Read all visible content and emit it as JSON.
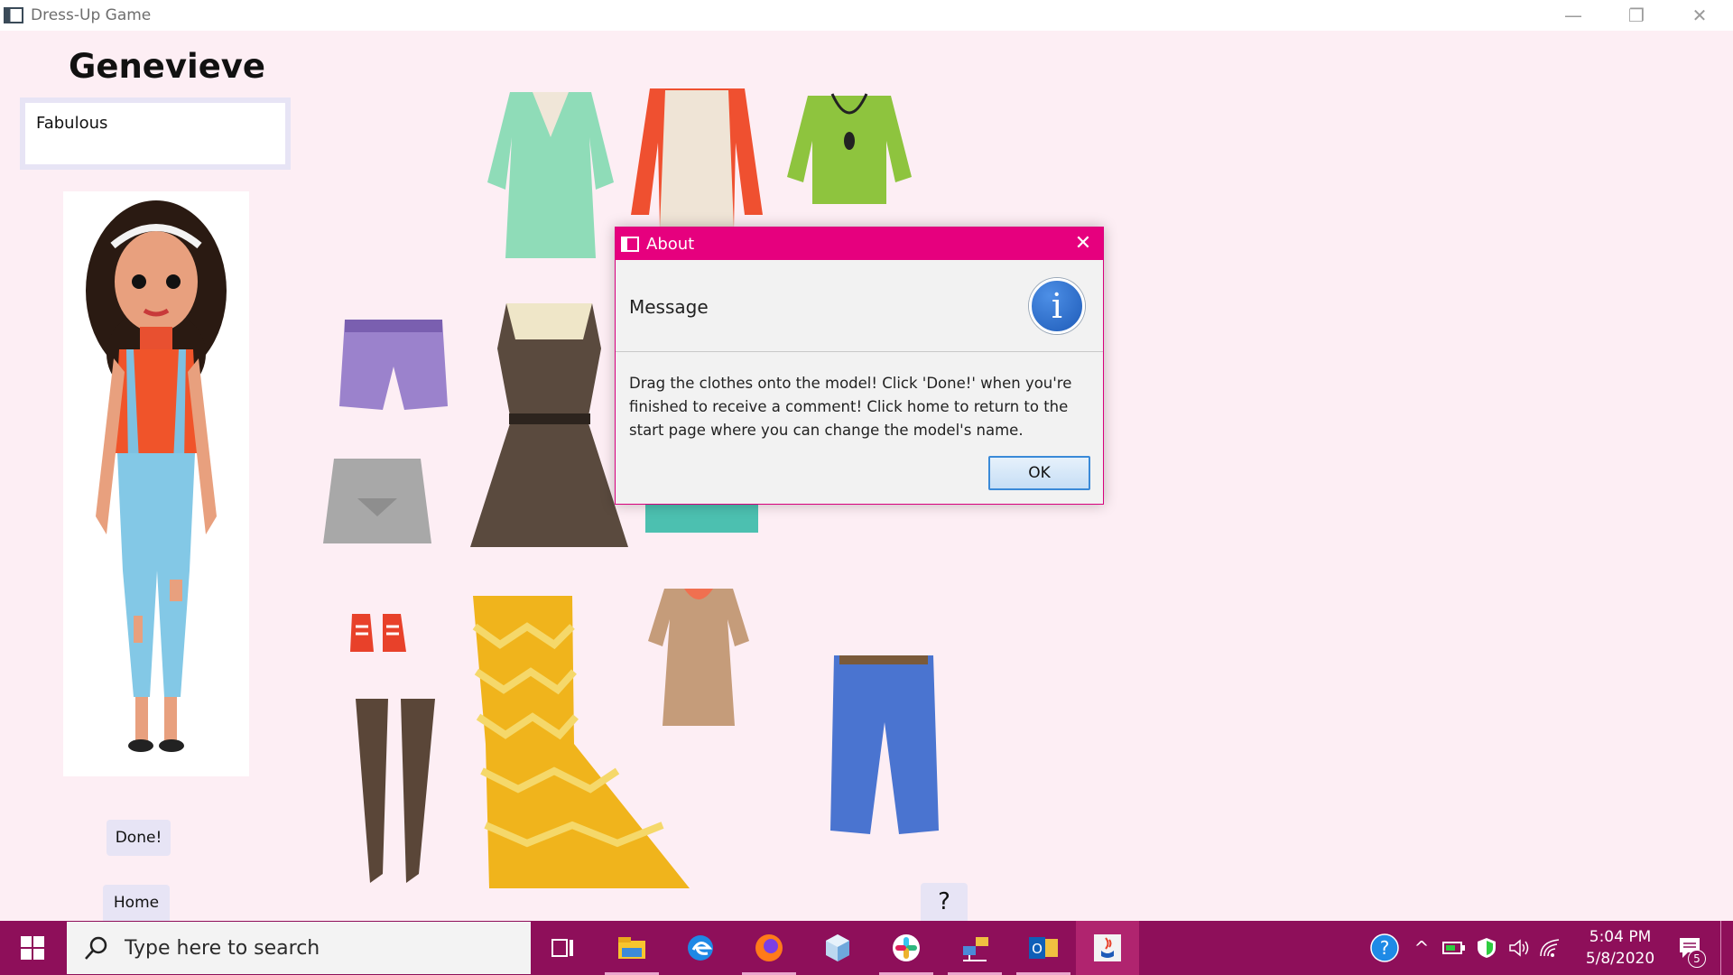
{
  "window": {
    "title": "Dress-Up Game"
  },
  "game": {
    "model_name": "Genevieve",
    "comment": "Fabulous",
    "done_label": "Done!",
    "home_label": "Home",
    "help_label": "?"
  },
  "dialog": {
    "title": "About",
    "header": "Message",
    "message": "Drag the clothes onto the model! Click 'Done!' when you're finished to receive a comment! Click home to return to the start page where you can change the model's name.",
    "ok_label": "OK",
    "icon": "info-icon"
  },
  "taskbar": {
    "search_placeholder": "Type here to search",
    "time": "5:04 PM",
    "date": "5/8/2020",
    "notification_count": "5",
    "apps": [
      "task-view",
      "file-explorer",
      "edge",
      "firefox",
      "3d-viewer",
      "slack",
      "network",
      "outlook",
      "java"
    ]
  },
  "colors": {
    "background": "#fdeef4",
    "dialog_accent": "#e6007e",
    "taskbar": "#8e0f5a",
    "button_soft": "#e7e4f5"
  }
}
